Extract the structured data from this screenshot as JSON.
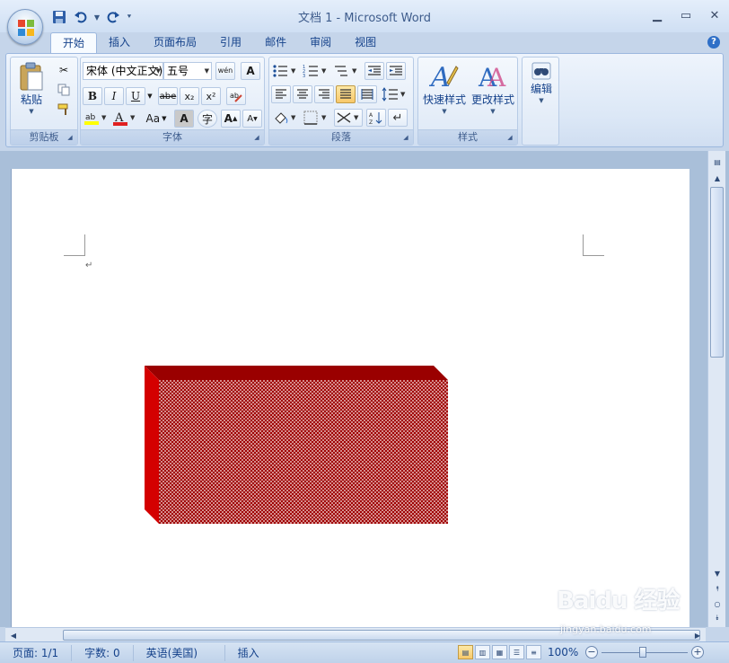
{
  "window": {
    "title": "文档 1 - Microsoft Word",
    "controls": [
      "_",
      "□",
      "×"
    ]
  },
  "quick_access": {
    "save_icon": "save-icon",
    "undo_icon": "undo-icon",
    "redo_icon": "redo-icon",
    "customize_icon": "customize-icon"
  },
  "tabs": [
    {
      "label": "开始",
      "active": true
    },
    {
      "label": "插入"
    },
    {
      "label": "页面布局"
    },
    {
      "label": "引用"
    },
    {
      "label": "邮件"
    },
    {
      "label": "审阅"
    },
    {
      "label": "视图"
    }
  ],
  "ribbon": {
    "clipboard": {
      "label": "剪贴板",
      "paste_label": "粘贴"
    },
    "font": {
      "label": "字体",
      "font_name": "宋体 (中文正文)",
      "font_size": "五号",
      "bold": "B",
      "italic": "I",
      "underline": "U",
      "strike": "abe",
      "subscript": "x₂",
      "superscript": "x²",
      "change_case": "Aa",
      "grow": "A",
      "shrink": "A",
      "wen": "wén",
      "char_border": "A",
      "char_shading": "A",
      "enclose": "字"
    },
    "paragraph": {
      "label": "段落"
    },
    "styles": {
      "label": "样式",
      "quick_styles": "快速样式",
      "change_styles": "更改样式"
    },
    "editing": {
      "label": "编辑"
    }
  },
  "document": {
    "shape": {
      "type": "3d-box",
      "front_color": "#a00000",
      "side_color": "#d40000",
      "top_color": "#8a0000"
    }
  },
  "statusbar": {
    "page": "页面: 1/1",
    "words": "字数: 0",
    "language": "英语(美国)",
    "mode": "插入",
    "zoom": "100%"
  },
  "watermark": {
    "main": "Baidu 经验",
    "sub": "jingyan.baidu.com"
  },
  "colors": {
    "ribbon_bg": "#dbe7f6",
    "accent": "#15428b",
    "active_btn": "#f8c86a"
  }
}
